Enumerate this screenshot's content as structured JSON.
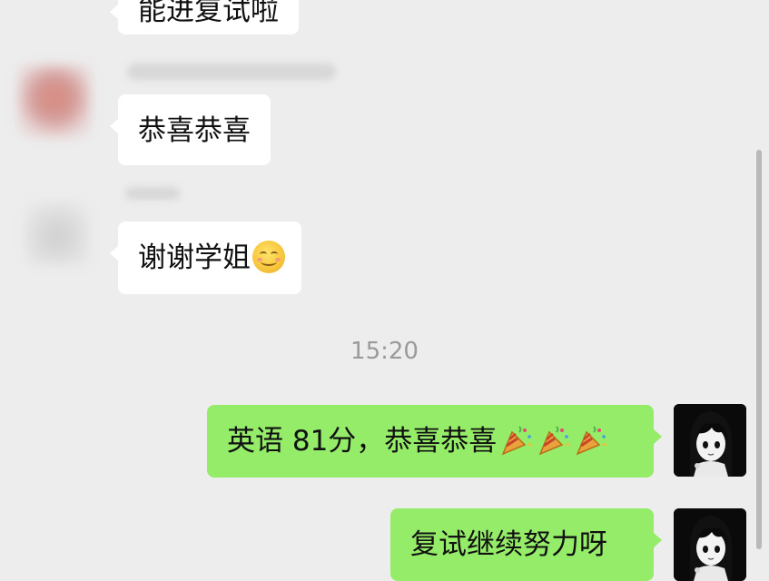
{
  "messages": {
    "top_partial": "能进复试啦",
    "congrats_reply": "恭喜恭喜",
    "thanks": "谢谢学姐",
    "timestamp": "15:20",
    "sent_1": "英语 81分，恭喜恭喜",
    "sent_2": "复试继续努力呀"
  },
  "icons": {
    "smile": "smiling-face-emoji",
    "popper": "party-popper-emoji"
  },
  "colors": {
    "background": "#ededed",
    "incoming_bubble": "#ffffff",
    "outgoing_bubble": "#95ec69",
    "timestamp": "#9a9a9a"
  }
}
